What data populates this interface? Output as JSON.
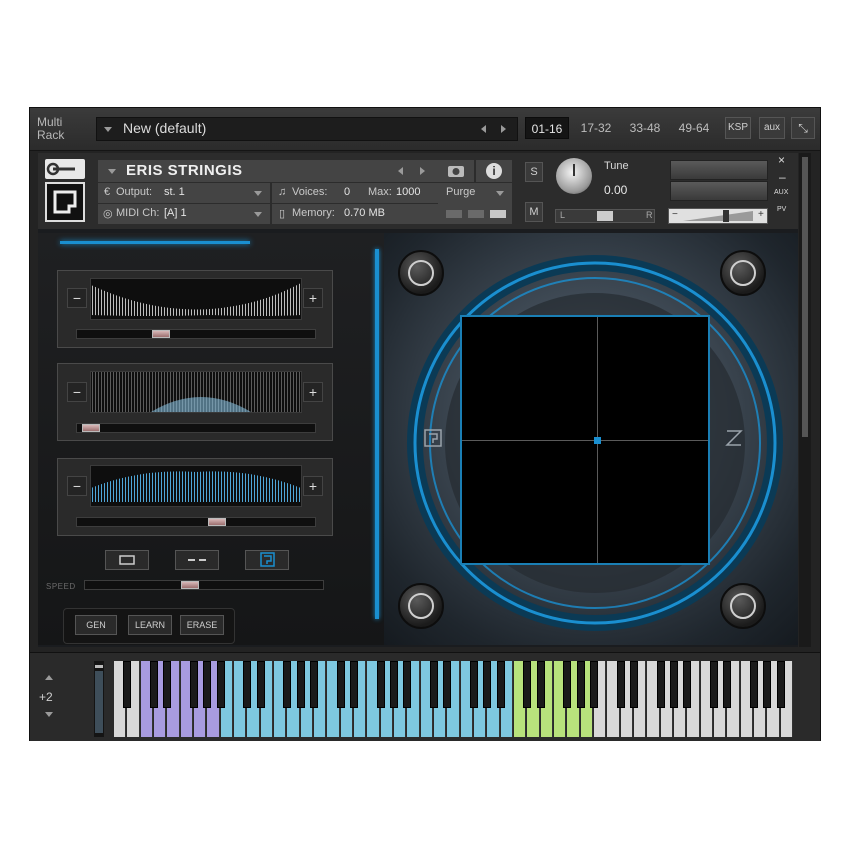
{
  "rack": {
    "multi_rack_line1": "Multi",
    "multi_rack_line2": "Rack",
    "preset_name": "New (default)",
    "tabs": [
      "01-16",
      "17-32",
      "33-48",
      "49-64"
    ],
    "selected_tab": "01-16",
    "ksp_label": "KSP",
    "aux_label": "aux"
  },
  "instrument": {
    "name": "ERIS STRINGIS",
    "output_label": "Output:",
    "output_value": "st. 1",
    "midi_label": "MIDI Ch:",
    "midi_value": "[A]  1",
    "voices_label": "Voices:",
    "voices_value": "0",
    "max_label": "Max:",
    "max_value": "1000",
    "memory_label": "Memory:",
    "memory_value": "0.70 MB",
    "purge_label": "Purge",
    "solo_label": "S",
    "mute_label": "M",
    "tune_label": "Tune",
    "tune_value": "0.00",
    "pan_left": "L",
    "pan_right": "R",
    "vol_minus": "−",
    "vol_plus": "+",
    "aux_side": "AUX",
    "pv_side": "PV"
  },
  "controls": {
    "speed_label": "SPEED",
    "gen_label": "GEN",
    "learn_label": "LEARN",
    "erase_label": "ERASE",
    "minus": "−",
    "plus": "+",
    "slider1_value": 0.46,
    "slider2_value": 0.05,
    "slider3_value": 0.58,
    "speed_value": 0.44
  },
  "keyboard": {
    "transpose": "+2"
  },
  "colors": {
    "accent_blue": "#1a8fd0",
    "key_purple": "#a89be0",
    "key_blue": "#7ec8e0",
    "key_green": "#b8e27c",
    "key_white": "#d8d8d8"
  }
}
